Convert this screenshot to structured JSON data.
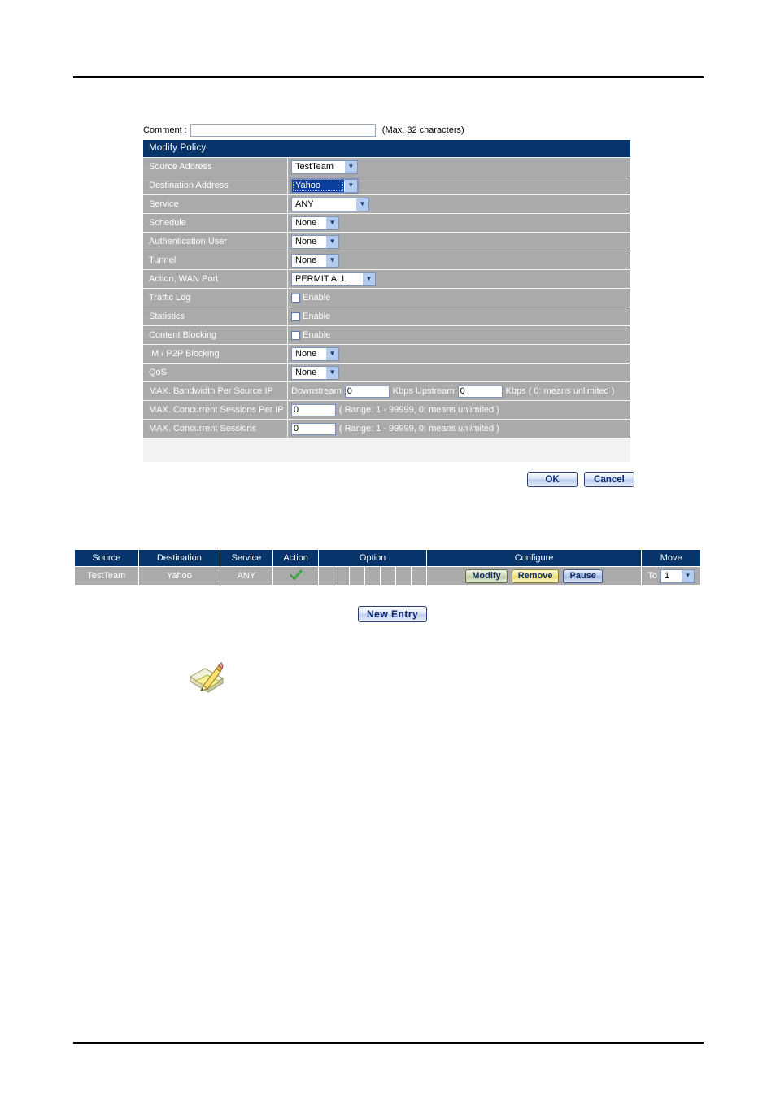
{
  "comment": {
    "label": "Comment :",
    "value": "",
    "placeholder": "",
    "hint": "(Max. 32 characters)"
  },
  "policy_form": {
    "title": "Modify Policy",
    "rows": [
      {
        "label": "Source Address",
        "control": "select",
        "value": "TestTeam"
      },
      {
        "label": "Destination Address",
        "control": "select",
        "value": "Yahoo"
      },
      {
        "label": "Service",
        "control": "select",
        "value": "ANY"
      },
      {
        "label": "Schedule",
        "control": "select",
        "value": "None"
      },
      {
        "label": "Authentication User",
        "control": "select",
        "value": "None"
      },
      {
        "label": "Tunnel",
        "control": "select",
        "value": "None"
      },
      {
        "label": "Action, WAN Port",
        "control": "select",
        "value": "PERMIT ALL"
      },
      {
        "label": "Traffic Log",
        "control": "checkbox",
        "value": "Enable",
        "checked": false
      },
      {
        "label": "Statistics",
        "control": "checkbox",
        "value": "Enable",
        "checked": false
      },
      {
        "label": "Content Blocking",
        "control": "checkbox",
        "value": "Enable",
        "checked": false
      },
      {
        "label": "IM / P2P Blocking",
        "control": "select",
        "value": "None"
      },
      {
        "label": "QoS",
        "control": "select",
        "value": "None"
      },
      {
        "label": "MAX. Bandwidth Per Source IP",
        "control": "bandwidth"
      },
      {
        "label": "MAX. Concurrent Sessions Per IP",
        "control": "sessions",
        "value": "0"
      },
      {
        "label": "MAX. Concurrent Sessions",
        "control": "sessions",
        "value": "0"
      }
    ],
    "bandwidth": {
      "downstream_label": "Downstream",
      "downstream_value": "0",
      "kbps_upstream_label": "Kbps Upstream",
      "upstream_value": "0",
      "kbps_suffix_label": "Kbps ( 0: means unlimited )"
    },
    "sessions_range_note": "( Range: 1 - 99999, 0: means unlimited )",
    "buttons": {
      "ok": "OK",
      "cancel": "Cancel"
    }
  },
  "policy_table": {
    "headers": [
      "Source",
      "Destination",
      "Service",
      "Action",
      "Option",
      "Configure",
      "Move"
    ],
    "rows": [
      {
        "source": "TestTeam",
        "destination": "Yahoo",
        "service": "ANY",
        "action_icon": "green-check-icon",
        "option_cells": [
          "",
          "",
          "",
          "",
          "",
          "",
          ""
        ],
        "configure": {
          "modify": "Modify",
          "remove": "Remove",
          "pause": "Pause"
        },
        "move": {
          "prefix": "To",
          "value": "1"
        }
      }
    ],
    "new_entry_label": "New Entry"
  },
  "colors": {
    "header_navy": "#06356b",
    "row_gray": "#aaaaaa",
    "select_focus_blue": "#0b3f9e",
    "check_green": "#3ec93e"
  }
}
